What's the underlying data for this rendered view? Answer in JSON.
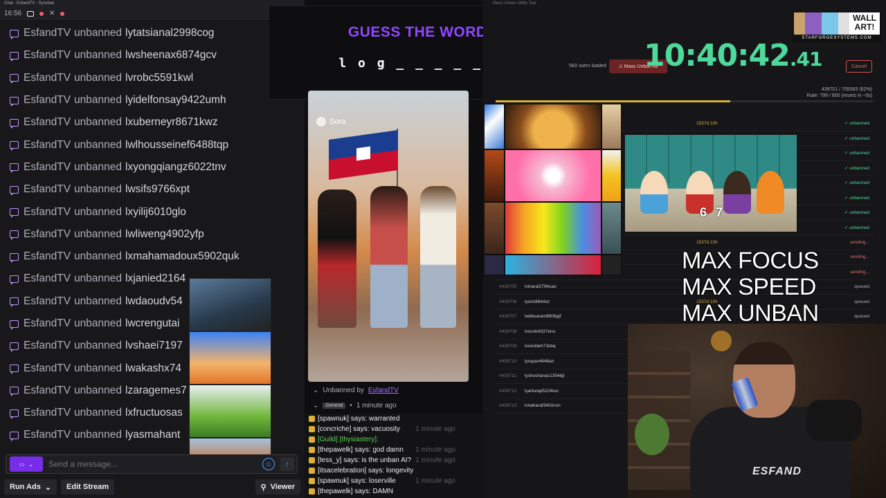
{
  "chat_window": {
    "title": "Chat - EsfandTV - Synctive",
    "time": "16:56"
  },
  "chat": {
    "messages": [
      {
        "who": "EsfandTV",
        "action": "unbanned",
        "target": "lytatsianal2998cog"
      },
      {
        "who": "EsfandTV",
        "action": "unbanned",
        "target": "lwsheenax6874gcv"
      },
      {
        "who": "EsfandTV",
        "action": "unbanned",
        "target": "lvrobc5591kwl"
      },
      {
        "who": "EsfandTV",
        "action": "unbanned",
        "target": "lyidelfonsay9422umh"
      },
      {
        "who": "EsfandTV",
        "action": "unbanned",
        "target": "lxuberneyr8671kwz"
      },
      {
        "who": "EsfandTV",
        "action": "unbanned",
        "target": "lwlhousseinef6488tqp"
      },
      {
        "who": "EsfandTV",
        "action": "unbanned",
        "target": "lxyongqiangz6022tnv"
      },
      {
        "who": "EsfandTV",
        "action": "unbanned",
        "target": "lwsifs9766xpt"
      },
      {
        "who": "EsfandTV",
        "action": "unbanned",
        "target": "lxyilij6010glo"
      },
      {
        "who": "EsfandTV",
        "action": "unbanned",
        "target": "lwliweng4902yfp"
      },
      {
        "who": "EsfandTV",
        "action": "unbanned",
        "target": "lxmahamadoux5902quk"
      },
      {
        "who": "EsfandTV",
        "action": "unbanned",
        "target": "lxjanied2164"
      },
      {
        "who": "EsfandTV",
        "action": "unbanned",
        "target": "lwdaoudv54"
      },
      {
        "who": "EsfandTV",
        "action": "unbanned",
        "target": "lwcrengutai"
      },
      {
        "who": "EsfandTV",
        "action": "unbanned",
        "target": "lvshaei7197"
      },
      {
        "who": "EsfandTV",
        "action": "unbanned",
        "target": "lwakashx74"
      },
      {
        "who": "EsfandTV",
        "action": "unbanned",
        "target": "lzaragemes7"
      },
      {
        "who": "EsfandTV",
        "action": "unbanned",
        "target": "lxfructuosas"
      },
      {
        "who": "EsfandTV",
        "action": "unbanned",
        "target": "lyasmahant"
      }
    ],
    "input_placeholder": "Send a message...",
    "run_ads": "Run Ads",
    "edit_stream": "Edit Stream",
    "viewer": "Viewer"
  },
  "guess": {
    "title": "GUESS THE WORD!",
    "word": "l o g _ _ _ _ _ _"
  },
  "video": {
    "watermark": "Sora"
  },
  "modchat": {
    "unban_by": "Unbanned by",
    "unban_user": "EsfandTV",
    "tag": "General",
    "time_ago": "1 minute ago",
    "lines": [
      {
        "text": "[spawnuk] says: warranted",
        "ghost": ""
      },
      {
        "text": "[concriche] says: vacuosity",
        "ghost": "1 minute ago"
      },
      {
        "text": "[Guild] [thysiastery]:",
        "ghost": "",
        "guild": true
      },
      {
        "text": "[thepawelk] says: god damn",
        "ghost": "1 minute ago"
      },
      {
        "text": "[tess_y] says: is the unban AI?",
        "ghost": "1 minute ago"
      },
      {
        "text": "[itsacelebration] says: longevity",
        "ghost": ""
      },
      {
        "text": "[spawnuk] says: loserville",
        "ghost": "1 minute ago"
      },
      {
        "text": "[thepawelk] says: DAMN",
        "ghost": ""
      },
      {
        "text": "Unbanned by EsfandTV",
        "ghost": "1 minute ago"
      }
    ]
  },
  "tool": {
    "title": "Mass Unban Utility Tool",
    "users_loaded": "583 users loaded",
    "mass_unban": "Mass Unban All",
    "cancel": "Cancel",
    "progress_a": "439701 / 705583 (62%)",
    "progress_b": "Rate: 799 / 800 (resets in ~0s)",
    "progress_fraction": 0.62,
    "clock_main": "10:40:42",
    "clock_ms": ".41",
    "jobs": [
      {
        "id": "",
        "user": "",
        "dur": "1537d 10h",
        "status": "unbanned"
      },
      {
        "id": "",
        "user": "",
        "dur": "",
        "status": "unbanned"
      },
      {
        "id": "",
        "user": "",
        "dur": "",
        "status": "unbanned"
      },
      {
        "id": "",
        "user": "",
        "dur": "",
        "status": "unbanned"
      },
      {
        "id": "",
        "user": "",
        "dur": "",
        "status": "unbanned"
      },
      {
        "id": "",
        "user": "",
        "dur": "",
        "status": "unbanned"
      },
      {
        "id": "",
        "user": "",
        "dur": "",
        "status": "unbanned"
      },
      {
        "id": "",
        "user": "",
        "dur": "",
        "status": "unbanned"
      },
      {
        "id": "",
        "user": "",
        "dur": "1537d 10h",
        "status": "sending..."
      },
      {
        "id": "",
        "user": "",
        "dur": "",
        "status": "sending..."
      },
      {
        "id": "",
        "user": "",
        "dur": "",
        "status": "sending..."
      },
      {
        "id": "#439705",
        "user": "lvinaral2794uao",
        "dur": "",
        "status": "queued"
      },
      {
        "id": "#439706",
        "user": "lyuriz864xbz",
        "dur": "1537d 10h",
        "status": "queued"
      },
      {
        "id": "#439707",
        "user": "lwilduaram8906pjf",
        "dur": "",
        "status": "queued"
      },
      {
        "id": "#439708",
        "user": "lxxunb4337eno",
        "dur": "",
        "status": "queued"
      },
      {
        "id": "#439709",
        "user": "lxcecilam71kbq",
        "dur": "",
        "status": "queued"
      },
      {
        "id": "#439710",
        "user": "lyrayax4646ari",
        "dur": "",
        "status": "queued"
      },
      {
        "id": "#439711",
        "user": "lyshoshanac1354bjt",
        "dur": "",
        "status": "queued"
      },
      {
        "id": "#439712",
        "user": "lyarturap5224tuo",
        "dur": "",
        "status": "queued"
      },
      {
        "id": "#439713",
        "user": "lvnaharaf3402con",
        "dur": "",
        "status": "queued"
      }
    ]
  },
  "overlay": {
    "sp_number": "6 7",
    "max_focus": "MAX FOCUS",
    "max_speed": "MAX SPEED",
    "max_unban": "MAX UNBAN",
    "logo_wall": "WALL",
    "logo_art": "ART!",
    "logo_sub": "STARFORGESYSTEMS.COM",
    "cam_brand": "ESFAND"
  }
}
